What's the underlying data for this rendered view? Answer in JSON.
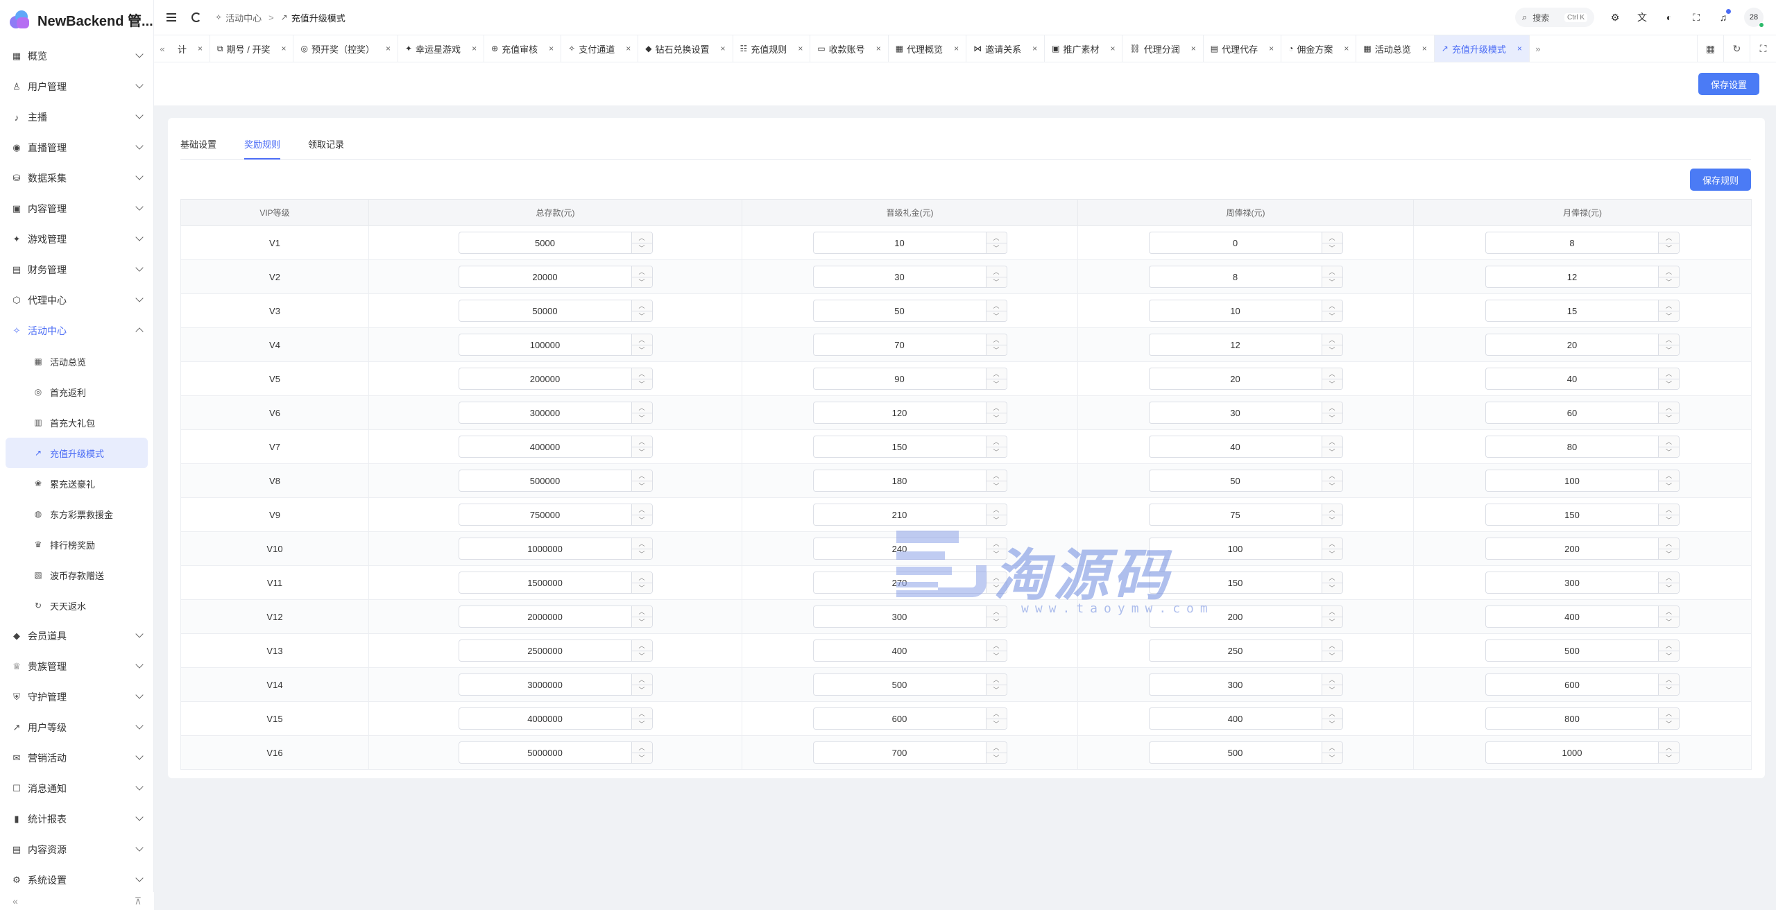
{
  "brand": "NewBackend 管...",
  "sidebar": {
    "items": [
      {
        "label": "概览",
        "icon": "▦"
      },
      {
        "label": "用户管理",
        "icon": "♙"
      },
      {
        "label": "主播",
        "icon": "♪"
      },
      {
        "label": "直播管理",
        "icon": "◉"
      },
      {
        "label": "数据采集",
        "icon": "⛁"
      },
      {
        "label": "内容管理",
        "icon": "▣"
      },
      {
        "label": "游戏管理",
        "icon": "✦"
      },
      {
        "label": "财务管理",
        "icon": "▤"
      },
      {
        "label": "代理中心",
        "icon": "⬡"
      },
      {
        "label": "活动中心",
        "icon": "✧"
      }
    ],
    "sub_items": [
      {
        "label": "活动总览",
        "icon": "▦"
      },
      {
        "label": "首充返利",
        "icon": "◎"
      },
      {
        "label": "首充大礼包",
        "icon": "▥"
      },
      {
        "label": "充值升级模式",
        "icon": "↗"
      },
      {
        "label": "累充送豪礼",
        "icon": "❀"
      },
      {
        "label": "东方彩票救援金",
        "icon": "◍"
      },
      {
        "label": "排行榜奖励",
        "icon": "♛"
      },
      {
        "label": "波币存款赠送",
        "icon": "▧"
      },
      {
        "label": "天天返水",
        "icon": "↻"
      }
    ],
    "items_after": [
      {
        "label": "会员道具",
        "icon": "◆"
      },
      {
        "label": "贵族管理",
        "icon": "♕"
      },
      {
        "label": "守护管理",
        "icon": "⛨"
      },
      {
        "label": "用户等级",
        "icon": "↗"
      },
      {
        "label": "营销活动",
        "icon": "✉"
      },
      {
        "label": "消息通知",
        "icon": "☐"
      },
      {
        "label": "统计报表",
        "icon": "▮"
      },
      {
        "label": "内容资源",
        "icon": "▤"
      },
      {
        "label": "系统设置",
        "icon": "⚙"
      }
    ],
    "collapse_icon": "«",
    "pin_icon": "⊼"
  },
  "header": {
    "breadcrumb": [
      "活动中心",
      "充值升级模式"
    ],
    "search_label": "搜索",
    "search_shortcut": "Ctrl K",
    "avatar_text": "28"
  },
  "tabs": [
    {
      "label": "计",
      "icon": ""
    },
    {
      "label": "期号 / 开奖",
      "icon": "⧉"
    },
    {
      "label": "预开奖（控奖）",
      "icon": "◎"
    },
    {
      "label": "幸运星游戏",
      "icon": "✦"
    },
    {
      "label": "充值审核",
      "icon": "⊕"
    },
    {
      "label": "支付通道",
      "icon": "✧"
    },
    {
      "label": "钻石兑换设置",
      "icon": "◆"
    },
    {
      "label": "充值规则",
      "icon": "☷"
    },
    {
      "label": "收款账号",
      "icon": "▭"
    },
    {
      "label": "代理概览",
      "icon": "▦"
    },
    {
      "label": "邀请关系",
      "icon": "⋈"
    },
    {
      "label": "推广素材",
      "icon": "▣"
    },
    {
      "label": "代理分润",
      "icon": "⛓"
    },
    {
      "label": "代理代存",
      "icon": "▤"
    },
    {
      "label": "佣金方案",
      "icon": "◔"
    },
    {
      "label": "活动总览",
      "icon": "▦"
    },
    {
      "label": "充值升级模式",
      "icon": "↗"
    }
  ],
  "buttons": {
    "save_settings": "保存设置",
    "save_rules": "保存规则"
  },
  "sub_tabs": [
    "基础设置",
    "奖励规则",
    "领取记录"
  ],
  "table": {
    "headers": [
      "VIP等级",
      "总存款(元)",
      "晋级礼金(元)",
      "周俸禄(元)",
      "月俸禄(元)"
    ],
    "rows": [
      [
        "V1",
        "5000",
        "10",
        "0",
        "8"
      ],
      [
        "V2",
        "20000",
        "30",
        "8",
        "12"
      ],
      [
        "V3",
        "50000",
        "50",
        "10",
        "15"
      ],
      [
        "V4",
        "100000",
        "70",
        "12",
        "20"
      ],
      [
        "V5",
        "200000",
        "90",
        "20",
        "40"
      ],
      [
        "V6",
        "300000",
        "120",
        "30",
        "60"
      ],
      [
        "V7",
        "400000",
        "150",
        "40",
        "80"
      ],
      [
        "V8",
        "500000",
        "180",
        "50",
        "100"
      ],
      [
        "V9",
        "750000",
        "210",
        "75",
        "150"
      ],
      [
        "V10",
        "1000000",
        "240",
        "100",
        "200"
      ],
      [
        "V11",
        "1500000",
        "270",
        "150",
        "300"
      ],
      [
        "V12",
        "2000000",
        "300",
        "200",
        "400"
      ],
      [
        "V13",
        "2500000",
        "400",
        "250",
        "500"
      ],
      [
        "V14",
        "3000000",
        "500",
        "300",
        "600"
      ],
      [
        "V15",
        "4000000",
        "600",
        "400",
        "800"
      ],
      [
        "V16",
        "5000000",
        "700",
        "500",
        "1000"
      ]
    ]
  },
  "watermark": {
    "text": "淘源码",
    "url": "www.taoymw.com"
  },
  "colors": {
    "accent": "#4b6cf5",
    "primary_button": "#4b7bf5",
    "active_bg": "#e8edfd"
  }
}
